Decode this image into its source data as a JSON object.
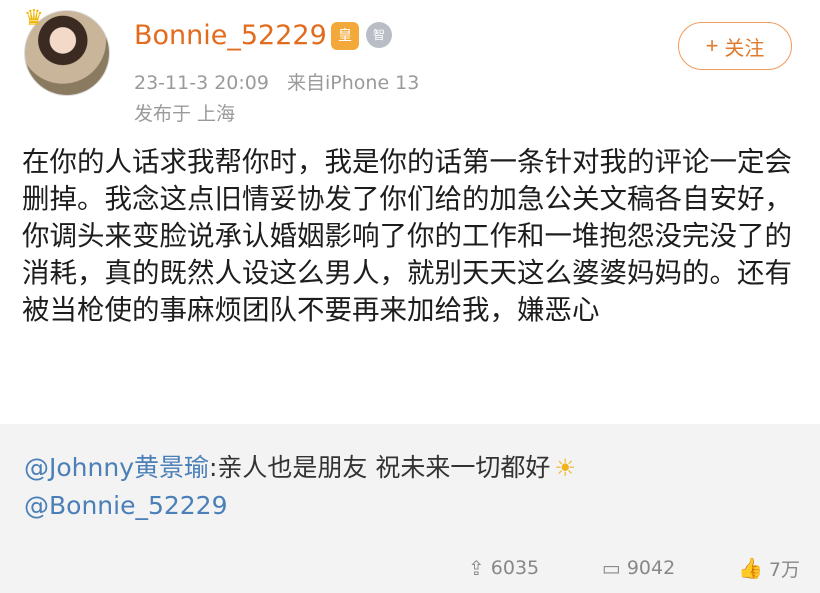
{
  "user": {
    "name": "Bonnie_52229",
    "vip_badge": "皇",
    "medal_badge": "智",
    "follow_label": "关注",
    "follow_plus": "+"
  },
  "meta": {
    "time": "23-11-3 20:09",
    "source": "来自iPhone 13",
    "location": "发布于 上海"
  },
  "post": {
    "text": "在你的人话求我帮你时，我是你的话第一条针对我的评论一定会删掉。我念这点旧情妥协发了你们给的加急公关文稿各自安好，你调头来变脸说承认婚姻影响了你的工作和一堆抱怨没完没了的消耗，真的既然人设这么男人，就别天天这么婆婆妈妈的。还有被当枪使的事麻烦团队不要再来加给我，嫌恶心"
  },
  "repost": {
    "mention1": "@Johnny黄景瑜",
    "text": ":亲人也是朋友 祝未来一切都好",
    "mention2": "@Bonnie_52229"
  },
  "actions": {
    "share_count": "6035",
    "comment_count": "9042",
    "like_count": "7万"
  },
  "icons": {
    "crown": "crown-icon",
    "sun": "sun-icon",
    "share": "share-icon",
    "comment": "comment-icon",
    "like": "thumbs-up-icon"
  },
  "colors": {
    "username": "#e26b1d",
    "mention": "#4a7fb8",
    "follow_border": "#f29a5a",
    "repost_bg": "#f3f3f3"
  }
}
